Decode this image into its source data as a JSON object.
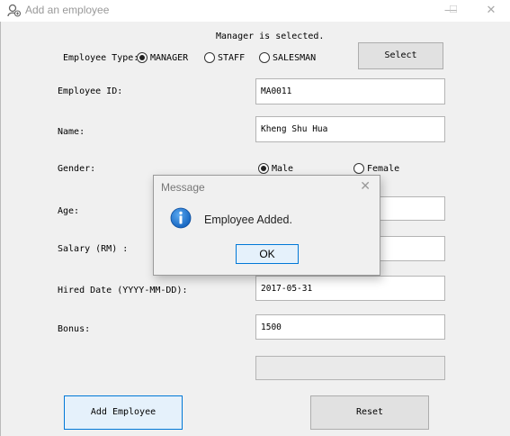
{
  "window": {
    "title": "Add an employee",
    "minimize": "—",
    "maximize": "☐",
    "close": "✕"
  },
  "status": "Manager is selected.",
  "employee_type": {
    "label": "Employee Type:",
    "options": [
      {
        "label": "MANAGER",
        "selected": true
      },
      {
        "label": "STAFF",
        "selected": false
      },
      {
        "label": "SALESMAN",
        "selected": false
      }
    ],
    "select_label": "Select"
  },
  "fields": {
    "employee_id": {
      "label": "Employee ID:",
      "value": "MA0011"
    },
    "name": {
      "label": "Name:",
      "value": "Kheng Shu Hua"
    },
    "gender": {
      "label": "Gender:",
      "options": [
        {
          "label": "Male",
          "selected": true
        },
        {
          "label": "Female",
          "selected": false
        }
      ]
    },
    "age": {
      "label": "Age:",
      "value": ""
    },
    "salary": {
      "label": "Salary (RM) :",
      "value": ""
    },
    "hired_date": {
      "label": "Hired Date (YYYY-MM-DD):",
      "value": "2017-05-31"
    },
    "bonus": {
      "label": "Bonus:",
      "value": "1500"
    },
    "extra": {
      "value": ""
    }
  },
  "buttons": {
    "add": "Add Employee",
    "reset": "Reset"
  },
  "dialog": {
    "title": "Message",
    "close": "✕",
    "message": "Employee Added.",
    "ok": "OK",
    "icon": "info-icon"
  },
  "colors": {
    "info_blue": "#1a73c7",
    "focus_border": "#0078d7"
  }
}
